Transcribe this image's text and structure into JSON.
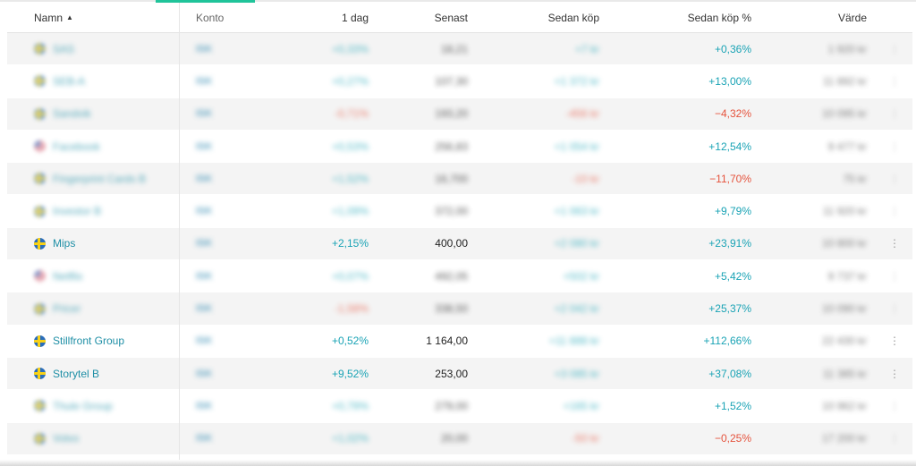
{
  "header": {
    "namn": "Namn",
    "sort_indicator": "▲",
    "konto": "Konto",
    "dag": "1 dag",
    "senast": "Senast",
    "sedan_kop": "Sedan köp",
    "sedan_kop_pct": "Sedan köp %",
    "varde": "Värde"
  },
  "rows": [
    {
      "flag": "se",
      "name": "SAS",
      "konto": "ISK",
      "dag": "+0,33%",
      "senast": "18,21",
      "sedan": "+7 kr",
      "sedan_pct": "+0,36%",
      "varde": "1 920 kr",
      "blurred": true
    },
    {
      "flag": "se",
      "name": "SEB-A",
      "konto": "ISK",
      "dag": "+0,27%",
      "senast": "107,30",
      "sedan": "+1 372 kr",
      "sedan_pct": "+13,00%",
      "varde": "11 892 kr",
      "blurred": true
    },
    {
      "flag": "se",
      "name": "Sandvik",
      "konto": "ISK",
      "dag": "-0,71%",
      "senast": "193,20",
      "sedan": "-456 kr",
      "sedan_pct": "−4,32%",
      "varde": "10 095 kr",
      "blurred": true
    },
    {
      "flag": "us",
      "name": "Facebook",
      "konto": "ISK",
      "dag": "+0,53%",
      "senast": "256,83",
      "sedan": "+1 054 kr",
      "sedan_pct": "+12,54%",
      "varde": "9 477 kr",
      "blurred": true
    },
    {
      "flag": "se",
      "name": "Fingerprint Cards B",
      "konto": "ISK",
      "dag": "+1,52%",
      "senast": "16,700",
      "sedan": "-10 kr",
      "sedan_pct": "−11,70%",
      "varde": "75 kr",
      "blurred": true
    },
    {
      "flag": "se",
      "name": "Investor B",
      "konto": "ISK",
      "dag": "+1,09%",
      "senast": "372,00",
      "sedan": "+1 063 kr",
      "sedan_pct": "+9,79%",
      "varde": "11 920 kr",
      "blurred": true
    },
    {
      "flag": "se",
      "name": "Mips",
      "konto": "ISK",
      "dag": "+2,15%",
      "senast": "400,00",
      "sedan": "+2 080 kr",
      "sedan_pct": "+23,91%",
      "varde": "10 800 kr",
      "blurred": false
    },
    {
      "flag": "us",
      "name": "Netflix",
      "konto": "ISK",
      "dag": "+0,07%",
      "senast": "492,05",
      "sedan": "+502 kr",
      "sedan_pct": "+5,42%",
      "varde": "9 737 kr",
      "blurred": true
    },
    {
      "flag": "se",
      "name": "Pricer",
      "konto": "ISK",
      "dag": "-1,58%",
      "senast": "338,50",
      "sedan": "+2 042 kr",
      "sedan_pct": "+25,37%",
      "varde": "10 090 kr",
      "blurred": true
    },
    {
      "flag": "se",
      "name": "Stillfront Group",
      "konto": "ISK",
      "dag": "+0,52%",
      "senast": "1 164,00",
      "sedan": "+11 888 kr",
      "sedan_pct": "+112,66%",
      "varde": "22 430 kr",
      "blurred": false
    },
    {
      "flag": "se",
      "name": "Storytel B",
      "konto": "ISK",
      "dag": "+9,52%",
      "senast": "253,00",
      "sedan": "+3 085 kr",
      "sedan_pct": "+37,08%",
      "varde": "11 385 kr",
      "blurred": false
    },
    {
      "flag": "se",
      "name": "Thule Group",
      "konto": "ISK",
      "dag": "+0,79%",
      "senast": "279,00",
      "sedan": "+165 kr",
      "sedan_pct": "+1,52%",
      "varde": "10 962 kr",
      "blurred": true
    },
    {
      "flag": "se",
      "name": "Volvo",
      "konto": "ISK",
      "dag": "+1,02%",
      "senast": "20,00",
      "sedan": "-50 kr",
      "sedan_pct": "−0,25%",
      "varde": "17 200 kr",
      "blurred": true
    }
  ],
  "row_menu_glyph": "⋮"
}
